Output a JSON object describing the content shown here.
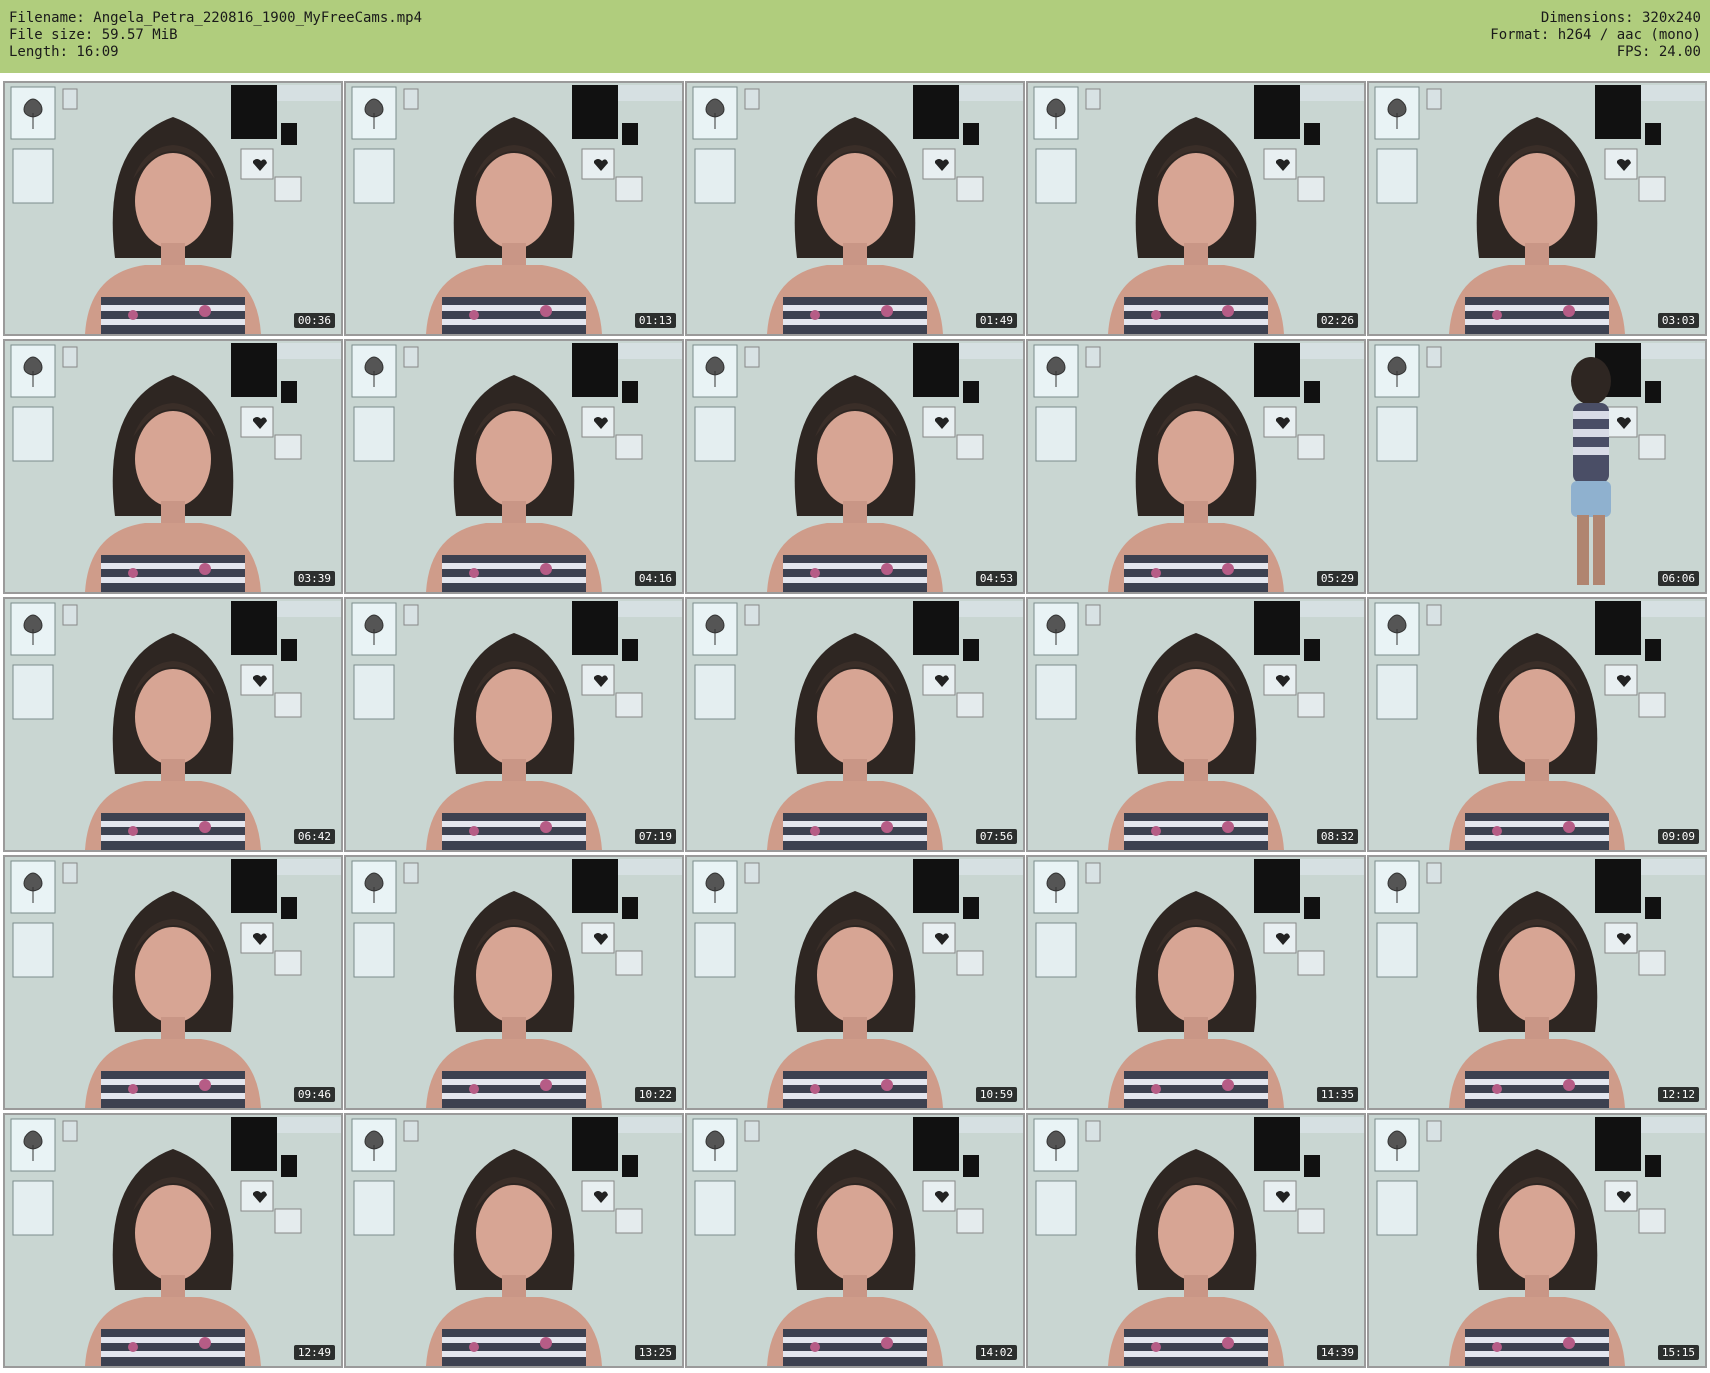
{
  "header": {
    "filename_line": "Filename: Angela_Petra_220816_1900_MyFreeCams.mp4",
    "filesize_line": "File size: 59.57 MiB",
    "length_line": "Length: 16:09",
    "dimensions_line": "Dimensions: 320x240",
    "format_line": "Format: h264 / aac (mono)",
    "fps_line": "FPS: 24.00"
  },
  "colors": {
    "header_bg": "#b0cd7d",
    "thumb_border": "#9a9a9a",
    "timestamp_bg": "#000000"
  },
  "thumbnails": [
    {
      "time": "00:36"
    },
    {
      "time": "01:13"
    },
    {
      "time": "01:49"
    },
    {
      "time": "02:26"
    },
    {
      "time": "03:03"
    },
    {
      "time": "03:39"
    },
    {
      "time": "04:16"
    },
    {
      "time": "04:53"
    },
    {
      "time": "05:29"
    },
    {
      "time": "06:06"
    },
    {
      "time": "06:42"
    },
    {
      "time": "07:19"
    },
    {
      "time": "07:56"
    },
    {
      "time": "08:32"
    },
    {
      "time": "09:09"
    },
    {
      "time": "09:46"
    },
    {
      "time": "10:22"
    },
    {
      "time": "10:59"
    },
    {
      "time": "11:35"
    },
    {
      "time": "12:12"
    },
    {
      "time": "12:49"
    },
    {
      "time": "13:25"
    },
    {
      "time": "14:02"
    },
    {
      "time": "14:39"
    },
    {
      "time": "15:15"
    }
  ]
}
